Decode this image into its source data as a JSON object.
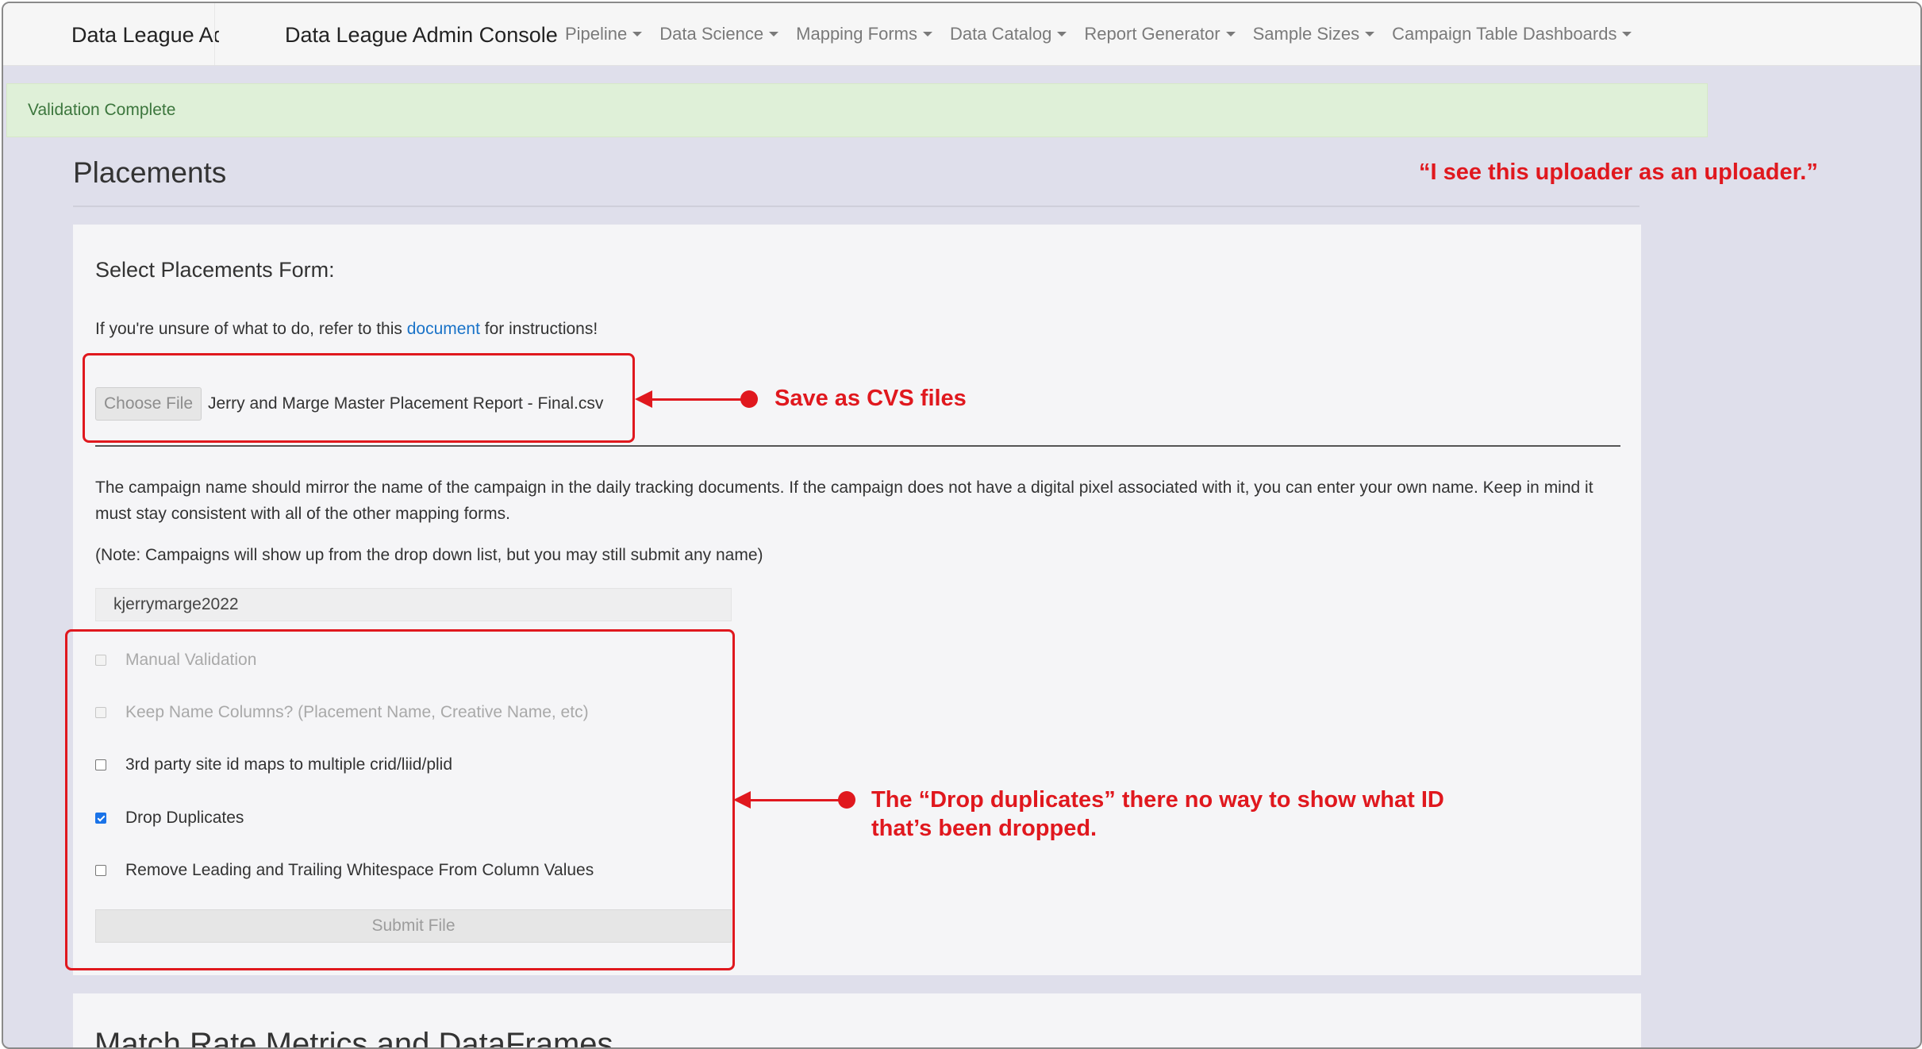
{
  "navbar": {
    "brand_short": "Data League Admin Console",
    "brand": "Data League Admin Console",
    "menu": [
      {
        "label": "Pipeline"
      },
      {
        "label": "Data Science"
      },
      {
        "label": "Mapping Forms"
      },
      {
        "label": "Data Catalog"
      },
      {
        "label": "Report Generator"
      },
      {
        "label": "Sample Sizes"
      },
      {
        "label": "Campaign Table Dashboards"
      }
    ]
  },
  "alert": {
    "text": "Validation Complete"
  },
  "page": {
    "title": "Placements"
  },
  "form": {
    "title": "Select Placements Form:",
    "instructions_prefix": "If you're unsure of what to do, refer to this ",
    "instructions_link": "document",
    "instructions_suffix": " for instructions!",
    "choose_file_label": "Choose File",
    "file_name": "Jerry and Marge Master Placement Report - Final.csv",
    "campaign_help": "The campaign name should mirror the name of the campaign in the daily tracking documents. If the campaign does not have a digital pixel associated with it, you can enter your own name. Keep in mind it must stay consistent with all of the other mapping forms.",
    "campaign_note": "(Note: Campaigns will show up from the drop down list, but you may still submit any name)",
    "campaign_value": "kjerrymarge2022",
    "checkboxes": [
      {
        "label": "Manual Validation",
        "checked": false,
        "disabled": true
      },
      {
        "label": "Keep Name Columns? (Placement Name, Creative Name, etc)",
        "checked": false,
        "disabled": true
      },
      {
        "label": "3rd party site id maps to multiple crid/liid/plid",
        "checked": false,
        "disabled": false
      },
      {
        "label": "Drop Duplicates",
        "checked": true,
        "disabled": false
      },
      {
        "label": "Remove Leading and Trailing Whitespace From Column Values",
        "checked": false,
        "disabled": false
      }
    ],
    "submit_label": "Submit File"
  },
  "next_section": {
    "title": "Match Rate Metrics and DataFrames"
  },
  "annotations": {
    "quote": "“I see this uploader as an uploader.”",
    "file_note": "Save as CVS files",
    "dup_note_line1": "The “Drop duplicates” there no way to show what ID",
    "dup_note_line2": "that’s been dropped.",
    "color": "#e0181e"
  }
}
